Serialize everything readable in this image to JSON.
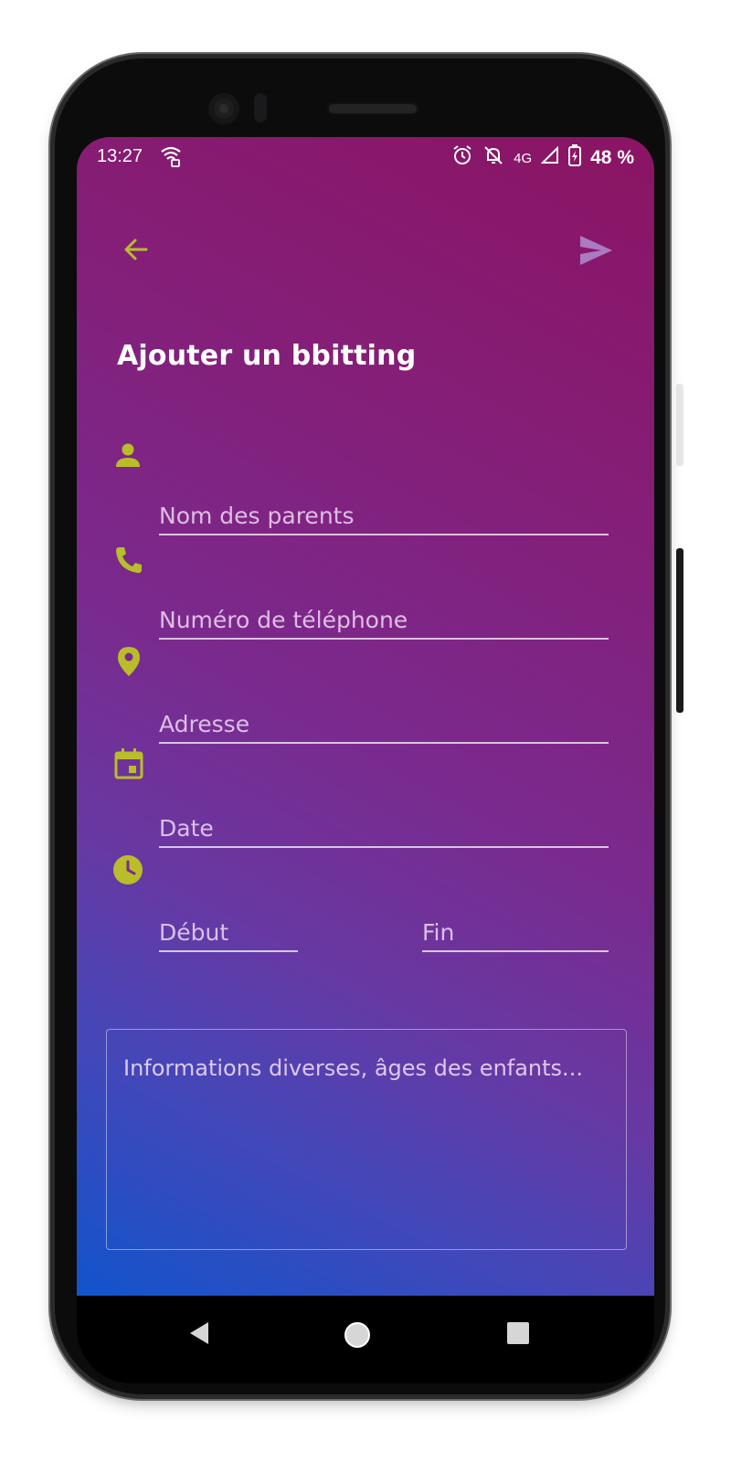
{
  "status_bar": {
    "time": "13:27",
    "network": "4G",
    "battery": "48 %"
  },
  "header": {
    "title": "Ajouter un bbitting"
  },
  "form": {
    "parents_placeholder": "Nom des parents",
    "phone_placeholder": "Numéro de téléphone",
    "address_placeholder": "Adresse",
    "date_placeholder": "Date",
    "start_placeholder": "Début",
    "end_placeholder": "Fin",
    "notes_placeholder": "Informations diverses, âges des enfants..."
  },
  "colors": {
    "accent": "#b9bd2a",
    "gradient_top": "#8b1463",
    "gradient_bottom": "#1254cc"
  },
  "icons": {
    "back": "arrow-left-icon",
    "send": "send-icon",
    "parents": "person-icon",
    "phone": "phone-icon",
    "address": "location-pin-icon",
    "date": "calendar-icon",
    "time": "clock-icon"
  }
}
